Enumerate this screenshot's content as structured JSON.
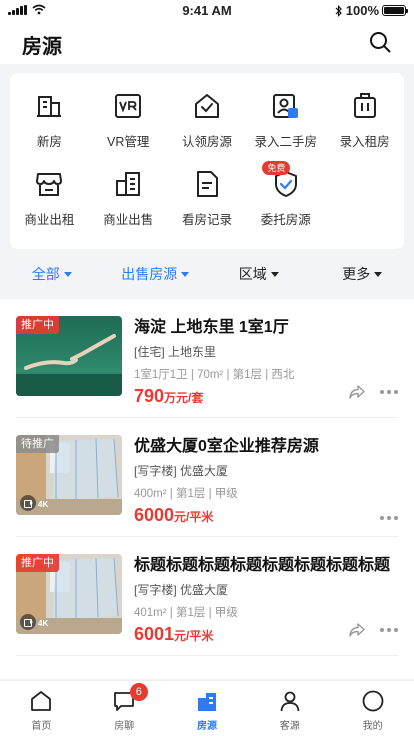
{
  "status_bar": {
    "time": "9:41 AM",
    "battery": "100%",
    "battery_level": 1.0
  },
  "header": {
    "title": "房源"
  },
  "services": [
    {
      "label": "新房",
      "icon": "building-icon"
    },
    {
      "label": "VR管理",
      "icon": "vr-icon"
    },
    {
      "label": "认领房源",
      "icon": "house-check-icon"
    },
    {
      "label": "录入二手房",
      "icon": "id-card-icon"
    },
    {
      "label": "录入租房",
      "icon": "door-icon"
    },
    {
      "label": "商业出租",
      "icon": "shop-icon"
    },
    {
      "label": "商业出售",
      "icon": "office-building-icon"
    },
    {
      "label": "看房记录",
      "icon": "document-icon"
    },
    {
      "label": "委托房源",
      "icon": "shield-check-icon",
      "badge": "免费"
    }
  ],
  "filters": [
    {
      "label": "全部",
      "active": true
    },
    {
      "label": "出售房源",
      "active": true
    },
    {
      "label": "区域",
      "active": false
    },
    {
      "label": "更多",
      "active": false
    }
  ],
  "listings": [
    {
      "tag": "推广中",
      "title": "海淀 上地东里 1室1厅",
      "subtitle": "[住宅] 上地东里",
      "details": "1室1厅1卫 | 70m² | 第1层 | 西北",
      "price": "790",
      "unit": "万元/套",
      "video": false,
      "share": true
    },
    {
      "tag": "待推广",
      "title": "优盛大厦0室企业推荐房源",
      "subtitle": "[写字楼] 优盛大厦",
      "details": "400m² | 第1层 | 甲级",
      "price": "6000",
      "unit": "元/平米",
      "video": true,
      "video_label": "4K",
      "share": false
    },
    {
      "tag": "推广中",
      "title": "标题标题标题标题标题标题标题标题",
      "subtitle": "[写字楼] 优盛大厦",
      "details": "401m² | 第1层 | 甲级",
      "price": "6001",
      "unit": "元/平米",
      "video": true,
      "video_label": "4K",
      "share": true
    }
  ],
  "tabbar": [
    {
      "label": "首页",
      "icon": "home-icon"
    },
    {
      "label": "房聊",
      "icon": "chat-icon",
      "badge": "6"
    },
    {
      "label": "房源",
      "icon": "listings-icon",
      "active": true
    },
    {
      "label": "客源",
      "icon": "person-icon"
    },
    {
      "label": "我的",
      "icon": "profile-circle-icon"
    }
  ],
  "colors": {
    "accent": "#2d7cf5",
    "price": "#e83a30",
    "badge": "#e83a30"
  }
}
